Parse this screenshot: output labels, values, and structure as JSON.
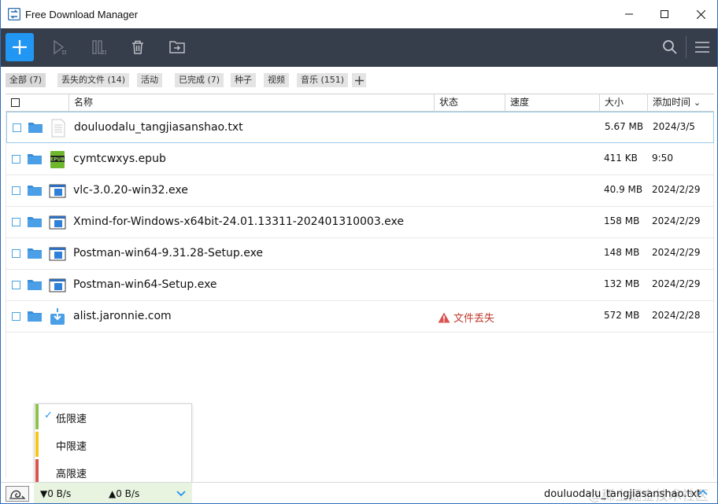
{
  "app": {
    "title": "Free Download Manager"
  },
  "tabs": [
    {
      "label": "全部 (7)",
      "active": true
    },
    {
      "label": "丢失的文件 (14)",
      "active": false
    },
    {
      "label": "活动",
      "active": false
    },
    {
      "label": "已完成 (7)",
      "active": false
    },
    {
      "label": "种子",
      "active": false
    },
    {
      "label": "视频",
      "active": false
    },
    {
      "label": "音乐 (151)",
      "active": false
    }
  ],
  "columns": {
    "name": "名称",
    "status": "状态",
    "speed": "速度",
    "size": "大小",
    "added": "添加时间",
    "sort_indicator": "⌄"
  },
  "rows": [
    {
      "name": "douluodalu_tangjiasanshao.txt",
      "status": "",
      "size": "5.67 MB",
      "added": "2024/3/5",
      "icon": "text-file-icon",
      "selected": true
    },
    {
      "name": "cymtcwxys.epub",
      "status": "",
      "size": "411 KB",
      "added": "9:50",
      "icon": "epub-file-icon",
      "selected": false
    },
    {
      "name": "vlc-3.0.20-win32.exe",
      "status": "",
      "size": "40.9 MB",
      "added": "2024/2/29",
      "icon": "exe-file-icon",
      "selected": false
    },
    {
      "name": "Xmind-for-Windows-x64bit-24.01.13311-202401310003.exe",
      "status": "",
      "size": "158 MB",
      "added": "2024/2/29",
      "icon": "exe-file-icon",
      "selected": false
    },
    {
      "name": "Postman-win64-9.31.28-Setup.exe",
      "status": "",
      "size": "148 MB",
      "added": "2024/2/29",
      "icon": "exe-file-icon",
      "selected": false
    },
    {
      "name": "Postman-win64-Setup.exe",
      "status": "",
      "size": "132 MB",
      "added": "2024/2/29",
      "icon": "exe-file-icon",
      "selected": false
    },
    {
      "name": "alist.jaronnie.com",
      "status": "文件丢失",
      "size": "572 MB",
      "added": "2024/2/28",
      "icon": "download-file-icon",
      "selected": false
    }
  ],
  "speed_menu": [
    {
      "label": "低限速",
      "checked": true,
      "color": "#8bc34a"
    },
    {
      "label": "中限速",
      "checked": false,
      "color": "#f5c518"
    },
    {
      "label": "高限速",
      "checked": false,
      "color": "#d9534f"
    }
  ],
  "statusbar": {
    "down_speed": "▼0 B/s",
    "up_speed": "▲0 B/s",
    "current_file": "douluodalu_tangjiasanshao.txt",
    "watermark": "@稀土掘金技术社区"
  },
  "colors": {
    "toolbar_bg": "#373e4b",
    "accent": "#2196f3",
    "error": "#c0392b"
  }
}
